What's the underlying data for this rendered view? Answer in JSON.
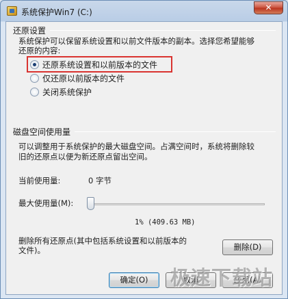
{
  "window": {
    "title": "系统保护Win7 (C:)",
    "close_label": "✕"
  },
  "restore": {
    "heading": "还原设置",
    "description_line1": "系统保护可以保留系统设置和以前文件版本的副本。选择您希望能够",
    "description_line2": "还原的内容:",
    "options": [
      {
        "label": "还原系统设置和以前版本的文件",
        "checked": true
      },
      {
        "label": "仅还原以前版本的文件",
        "checked": false
      },
      {
        "label": "关闭系统保护",
        "checked": false
      }
    ]
  },
  "disk": {
    "heading": "磁盘空间使用量",
    "description_line1": "可以调整用于系统保护的最大磁盘空间。占满空间时，系统将删除较",
    "description_line2": "旧的还原点以便为新还原点留出空间。",
    "current_label": "当前使用量:",
    "current_value": "0 字节",
    "max_label": "最大使用量(M):",
    "slider_value_text": "1% (409.63 MB)",
    "slider_percent": 1,
    "delete_text_line1": "删除所有还原点(其中包括系统设置和以前版本的",
    "delete_text_line2": "文件)。",
    "delete_button": "删除(D)"
  },
  "footer": {
    "ok_button": "确定(O)",
    "cancel_button": "取消",
    "apply_button": "应用(A)"
  },
  "watermark": "极速下载站",
  "colors": {
    "highlight": "#d9322f",
    "close_button": "#c9503b"
  }
}
